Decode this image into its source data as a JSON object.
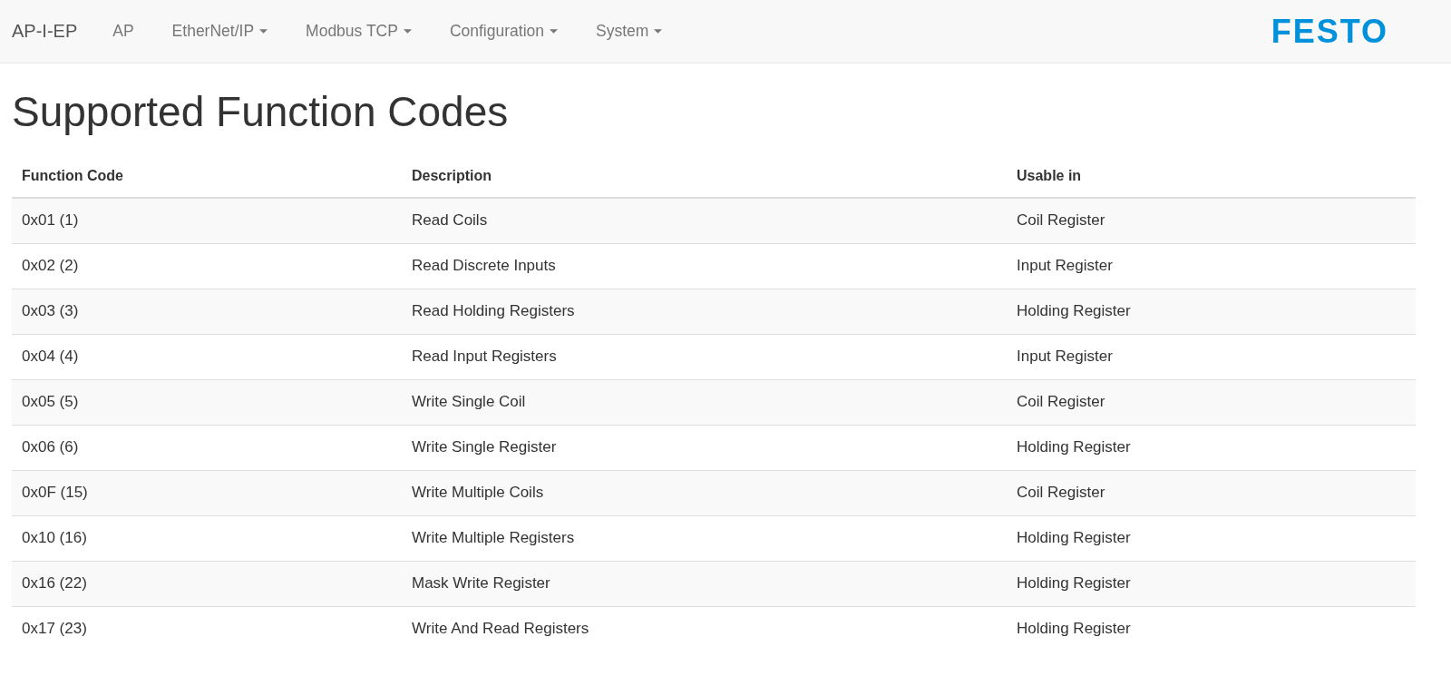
{
  "navbar": {
    "brand": "AP-I-EP",
    "items": [
      {
        "label": "AP",
        "dropdown": false
      },
      {
        "label": "EtherNet/IP",
        "dropdown": true
      },
      {
        "label": "Modbus TCP",
        "dropdown": true
      },
      {
        "label": "Configuration",
        "dropdown": true
      },
      {
        "label": "System",
        "dropdown": true
      }
    ],
    "logo": "FESTO"
  },
  "heading": "Supported Function Codes",
  "table": {
    "columns": [
      "Function Code",
      "Description",
      "Usable in"
    ],
    "rows": [
      [
        "0x01 (1)",
        "Read Coils",
        "Coil Register"
      ],
      [
        "0x02 (2)",
        "Read Discrete Inputs",
        "Input Register"
      ],
      [
        "0x03 (3)",
        "Read Holding Registers",
        "Holding Register"
      ],
      [
        "0x04 (4)",
        "Read Input Registers",
        "Input Register"
      ],
      [
        "0x05 (5)",
        "Write Single Coil",
        "Coil Register"
      ],
      [
        "0x06 (6)",
        "Write Single Register",
        "Holding Register"
      ],
      [
        "0x0F (15)",
        "Write Multiple Coils",
        "Coil Register"
      ],
      [
        "0x10 (16)",
        "Write Multiple Registers",
        "Holding Register"
      ],
      [
        "0x16 (22)",
        "Mask Write Register",
        "Holding Register"
      ],
      [
        "0x17 (23)",
        "Write And Read Registers",
        "Holding Register"
      ]
    ]
  }
}
